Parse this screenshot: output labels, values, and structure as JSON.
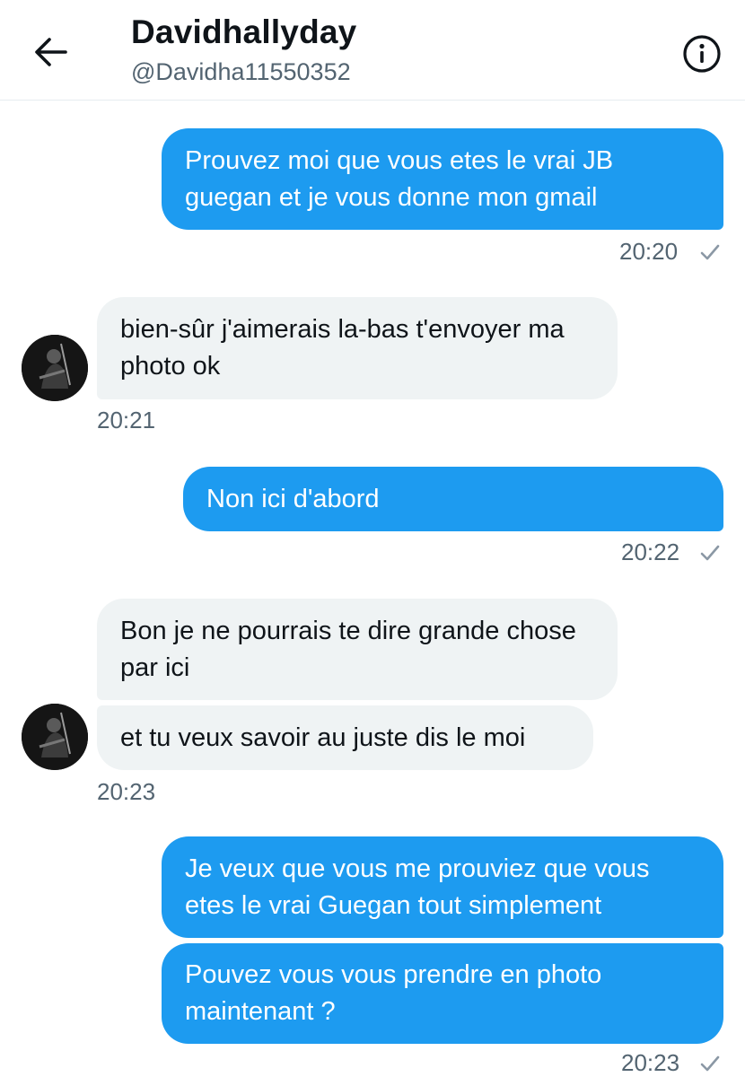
{
  "header": {
    "back_icon": "arrow-left-icon",
    "title": "Davidhallyday",
    "handle": "@Davidha11550352",
    "info_icon": "info-circle-icon"
  },
  "colors": {
    "sent_bubble": "#1d9bf0",
    "received_bubble": "#eff3f4",
    "muted_text": "#536471"
  },
  "messages": [
    {
      "direction": "sent",
      "text": "Prouvez moi que vous etes le vrai JB guegan et je vous donne mon gmail"
    },
    {
      "direction": "sent",
      "time": "20:20",
      "status": "sent"
    },
    {
      "direction": "received",
      "text": "bien-sûr j'aimerais la-bas t'envoyer ma photo ok"
    },
    {
      "direction": "received",
      "time": "20:21"
    },
    {
      "direction": "sent",
      "text": "Non ici d'abord"
    },
    {
      "direction": "sent",
      "time": "20:22",
      "status": "sent"
    },
    {
      "direction": "received",
      "text": "Bon je ne pourrais te dire grande chose par ici"
    },
    {
      "direction": "received",
      "text": "et tu veux savoir au juste dis le moi"
    },
    {
      "direction": "received",
      "time": "20:23"
    },
    {
      "direction": "sent",
      "text": "Je veux que vous me prouviez que vous etes le vrai Guegan tout simplement"
    },
    {
      "direction": "sent",
      "text": "Pouvez vous vous prendre en photo maintenant ?"
    },
    {
      "direction": "sent",
      "time": "20:23",
      "status": "sent"
    }
  ]
}
